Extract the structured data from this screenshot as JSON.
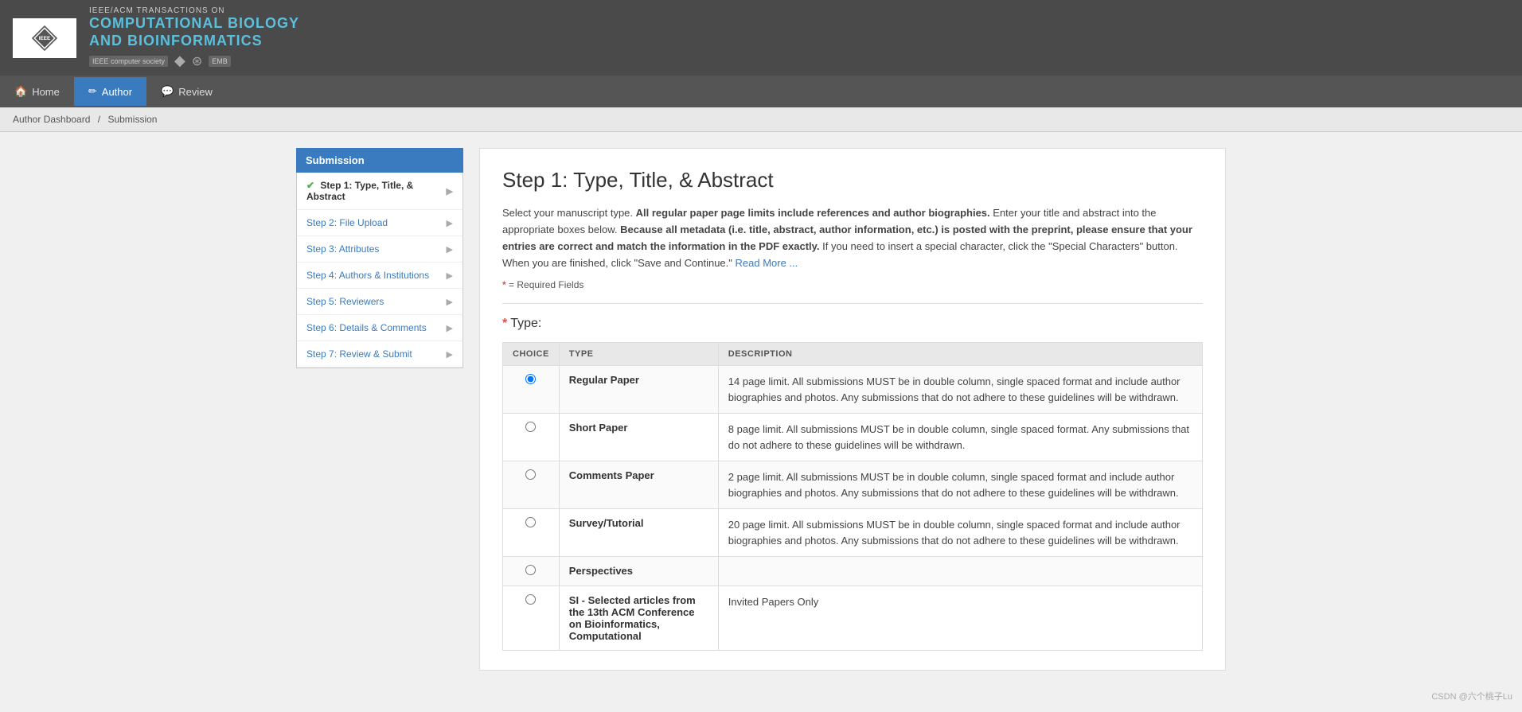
{
  "header": {
    "journal_pre": "IEEE/ACM TRANSACTIONS ON",
    "journal_name": "COMPUTATIONAL BIOLOGY\nAND BIOINFORMATICS",
    "ieee_label": "IEEE",
    "sponsors": [
      "IEEE computer society",
      "IEEE",
      "EMB"
    ]
  },
  "nav": {
    "items": [
      {
        "label": "Home",
        "icon": "🏠",
        "active": false
      },
      {
        "label": "Author",
        "icon": "✏",
        "active": true
      },
      {
        "label": "Review",
        "icon": "💬",
        "active": false
      }
    ]
  },
  "breadcrumb": {
    "items": [
      "Author Dashboard",
      "Submission"
    ],
    "separator": "/"
  },
  "sidebar": {
    "title": "Submission",
    "steps": [
      {
        "label": "Step 1: Type, Title, & Abstract",
        "active": true,
        "checked": true
      },
      {
        "label": "Step 2: File Upload",
        "active": false,
        "checked": false
      },
      {
        "label": "Step 3: Attributes",
        "active": false,
        "checked": false
      },
      {
        "label": "Step 4: Authors & Institutions",
        "active": false,
        "checked": false
      },
      {
        "label": "Step 5: Reviewers",
        "active": false,
        "checked": false
      },
      {
        "label": "Step 6: Details & Comments",
        "active": false,
        "checked": false
      },
      {
        "label": "Step 7: Review & Submit",
        "active": false,
        "checked": false
      }
    ]
  },
  "form": {
    "page_title": "Step 1: Type, Title, & Abstract",
    "intro": {
      "p1_normal": "Select your manuscript type. ",
      "p1_bold": "All regular paper page limits include references and author biographies.",
      "p1_rest": " Enter your title and abstract into the appropriate boxes below. ",
      "p2_bold": "Because all metadata (i.e. title, abstract, author information, etc.) is posted with the preprint, please ensure that your entries are correct and match the information in the PDF exactly.",
      "p2_rest": " If you need to insert a special character, click the \"Special Characters\" button. When you are finished, click \"Save and Continue.\"",
      "read_more": "Read More ...",
      "required_note": "= Required Fields"
    },
    "type_section": {
      "label": "Type:",
      "required": true,
      "columns": [
        "CHOICE",
        "TYPE",
        "DESCRIPTION"
      ],
      "options": [
        {
          "selected": true,
          "name": "Regular Paper",
          "description": "14 page limit. All submissions MUST be in double column, single spaced format and include author biographies and photos. Any submissions that do not adhere to these guidelines will be withdrawn."
        },
        {
          "selected": false,
          "name": "Short Paper",
          "description": "8 page limit. All submissions MUST be in double column, single spaced format. Any submissions that do not adhere to these guidelines will be withdrawn."
        },
        {
          "selected": false,
          "name": "Comments Paper",
          "description": "2 page limit. All submissions MUST be in double column, single spaced format and include author biographies and photos. Any submissions that do not adhere to these guidelines will be withdrawn."
        },
        {
          "selected": false,
          "name": "Survey/Tutorial",
          "description": "20 page limit. All submissions MUST be in double column, single spaced format and include author biographies and photos. Any submissions that do not adhere to these guidelines will be withdrawn."
        },
        {
          "selected": false,
          "name": "Perspectives",
          "description": ""
        },
        {
          "selected": false,
          "name": "SI - Selected articles from the 13th ACM Conference on Bioinformatics, Computational",
          "description": "Invited Papers Only"
        }
      ]
    }
  }
}
